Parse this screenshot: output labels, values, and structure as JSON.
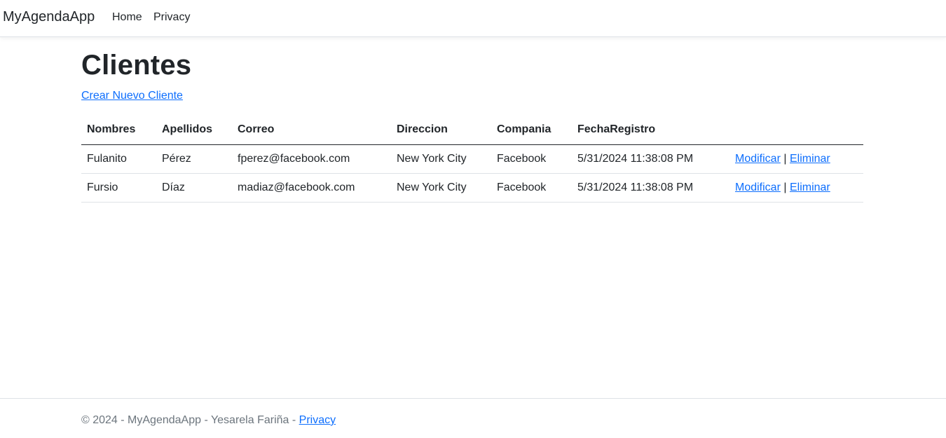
{
  "nav": {
    "brand": "MyAgendaApp",
    "links": [
      "Home",
      "Privacy"
    ]
  },
  "page": {
    "title": "Clientes",
    "create_link": "Crear Nuevo Cliente"
  },
  "table": {
    "headers": [
      "Nombres",
      "Apellidos",
      "Correo",
      "Direccion",
      "Compania",
      "FechaRegistro",
      ""
    ],
    "rows": [
      {
        "cells": [
          "Fulanito",
          "Pérez",
          "fperez@facebook.com",
          "New York City",
          "Facebook",
          "5/31/2024 11:38:08 PM"
        ],
        "edit": "Modificar",
        "sep": "|",
        "delete": "Eliminar"
      },
      {
        "cells": [
          "Fursio",
          "Díaz",
          "madiaz@facebook.com",
          "New York City",
          "Facebook",
          "5/31/2024 11:38:08 PM"
        ],
        "edit": "Modificar",
        "sep": "|",
        "delete": "Eliminar"
      }
    ]
  },
  "footer": {
    "text": "© 2024 - MyAgendaApp - Yesarela Fariña - ",
    "privacy": "Privacy"
  },
  "colors": {
    "link": "#0d6efd",
    "text": "#212529",
    "muted": "#6c757d",
    "border": "#dee2e6"
  }
}
